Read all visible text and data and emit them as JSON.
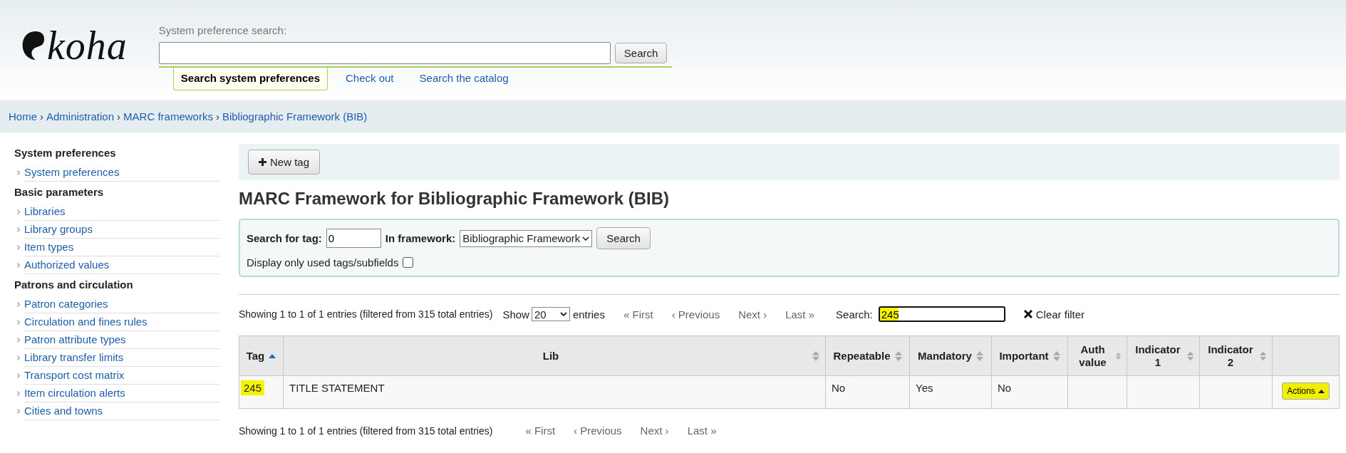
{
  "header": {
    "logo": "koha",
    "search_label": "System preference search:",
    "search_button": "Search",
    "tabs": [
      {
        "label": "Search system preferences",
        "selected": true
      },
      {
        "label": "Check out",
        "selected": false
      },
      {
        "label": "Search the catalog",
        "selected": false
      }
    ]
  },
  "breadcrumbs": {
    "separator": "›",
    "items": [
      "Home",
      "Administration",
      "MARC frameworks",
      "Bibliographic Framework (BIB)"
    ]
  },
  "sidebar": [
    {
      "heading": "System preferences",
      "items": [
        "System preferences"
      ]
    },
    {
      "heading": "Basic parameters",
      "items": [
        "Libraries",
        "Library groups",
        "Item types",
        "Authorized values"
      ]
    },
    {
      "heading": "Patrons and circulation",
      "items": [
        "Patron categories",
        "Circulation and fines rules",
        "Patron attribute types",
        "Library transfer limits",
        "Transport cost matrix",
        "Item circulation alerts",
        "Cities and towns"
      ]
    }
  ],
  "toolbar": {
    "new_button": "New tag"
  },
  "title": "MARC Framework for Bibliographic Framework (BIB)",
  "filter_form": {
    "tag_label": "Search for tag:",
    "tag_value": "0",
    "framework_label": "In framework:",
    "framework_value": "Bibliographic Framework",
    "search_button": "Search",
    "used_only_label": "Display only used tags/subfields",
    "used_only_checked": false
  },
  "table_info": {
    "summary": "Showing 1 to 1 of 1 entries (filtered from 315 total entries)",
    "show_label": "Show",
    "page_size": "20",
    "entries_label": "entries",
    "pager": [
      "« First",
      "‹ Previous",
      "Next ›",
      "Last »"
    ],
    "search_label": "Search:",
    "search_value": "245",
    "search_highlighted": true,
    "clear_filter": "Clear filter"
  },
  "table": {
    "columns": [
      {
        "label": "Tag",
        "sortable": true,
        "sorted": true
      },
      {
        "label": "Lib",
        "sortable": true,
        "sorted": false
      },
      {
        "label": "Repeatable",
        "sortable": true,
        "sorted": false
      },
      {
        "label": "Mandatory",
        "sortable": true,
        "sorted": false
      },
      {
        "label": "Important",
        "sortable": true,
        "sorted": false
      },
      {
        "label": "Auth value",
        "sortable": true,
        "sorted": false
      },
      {
        "label": "Indicator 1",
        "sortable": true,
        "sorted": false
      },
      {
        "label": "Indicator 2",
        "sortable": true,
        "sorted": false
      },
      {
        "sortable": false,
        "sorted": false
      }
    ],
    "rows": [
      {
        "tag": "245",
        "tag_highlighted": true,
        "lib": "TITLE STATEMENT",
        "repeatable": "No",
        "mandatory": "Yes",
        "important": "No",
        "actions": "Actions",
        "actions_highlighted": true
      }
    ]
  },
  "bottom_info": {
    "summary": "Showing 1 to 1 of 1 entries (filtered from 315 total entries)",
    "pager": [
      "« First",
      "‹ Previous",
      "Next ›",
      "Last »"
    ]
  }
}
